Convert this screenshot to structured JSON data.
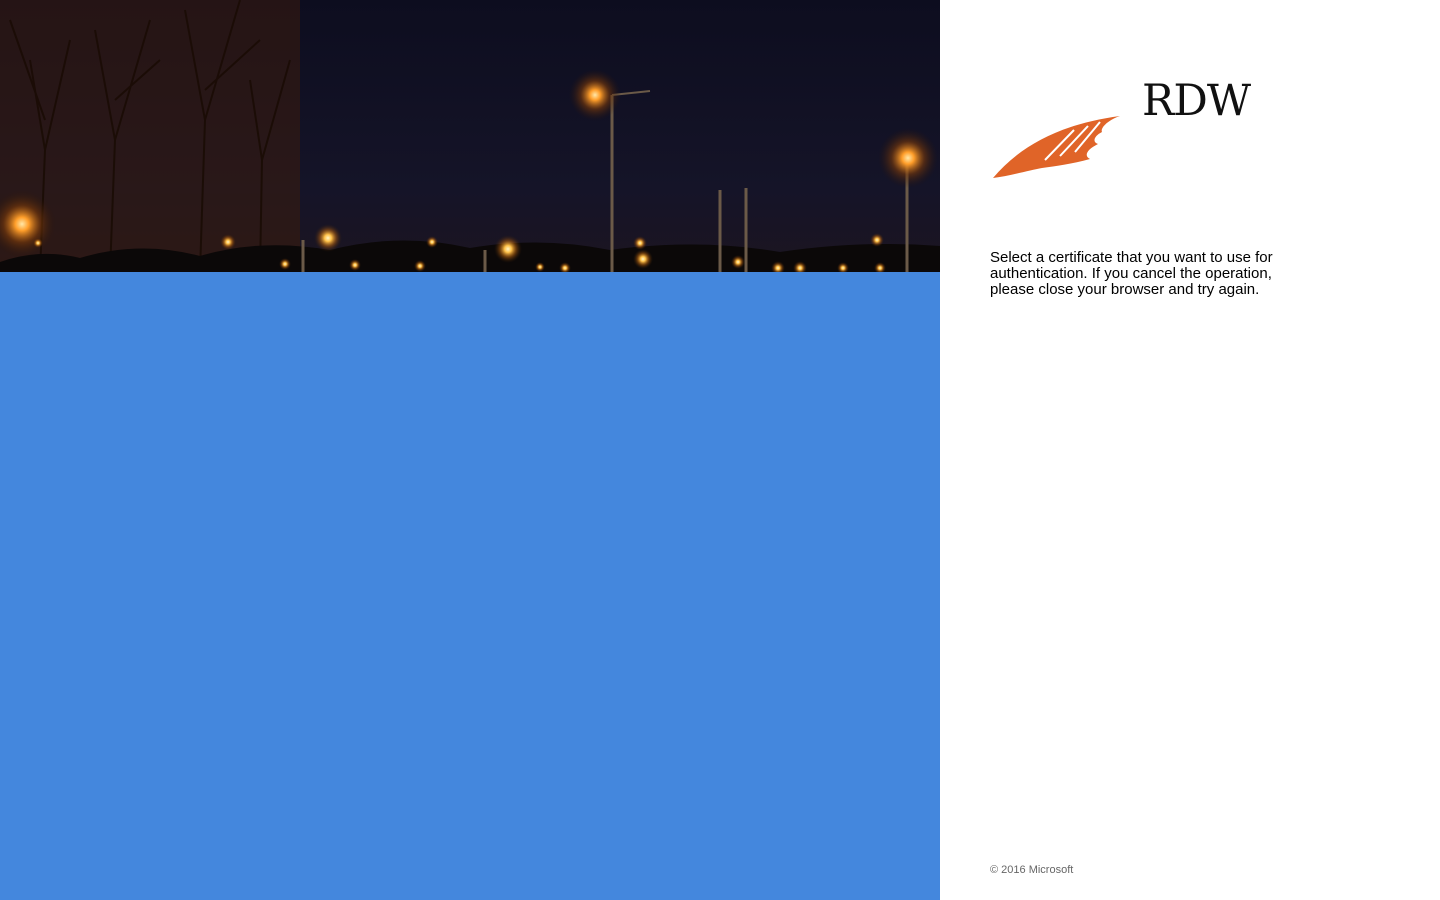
{
  "branding": {
    "logo_text": "RDW",
    "logo_icon": "rdw-feather-icon",
    "accent_color": "#e06428"
  },
  "illustration": {
    "description_icon": "street-lights-night-photo",
    "panel_color": "#4487dd"
  },
  "main": {
    "intro_text": "Select a certificate that you want to use for authentication. If you cancel the operation, please close your browser and try again."
  },
  "footer": {
    "copyright": "© 2016 Microsoft"
  }
}
